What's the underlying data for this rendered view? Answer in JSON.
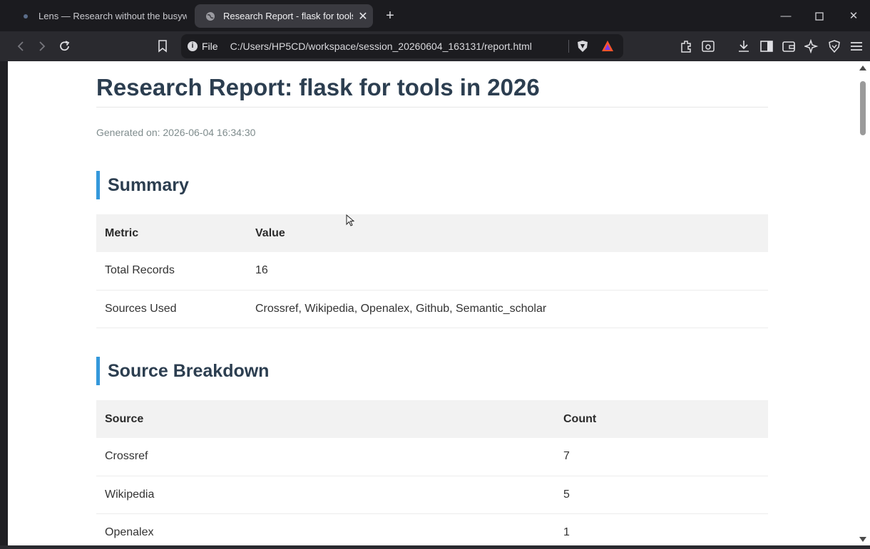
{
  "tabs": [
    {
      "title": "Lens — Research without the busywo",
      "active": false
    },
    {
      "title": "Research Report - flask for tools",
      "active": true
    }
  ],
  "toolbar": {
    "scheme": "File",
    "url": "C:/Users/HP5CD/workspace/session_20260604_163131/report.html"
  },
  "report": {
    "title": "Research Report: flask for tools in 2026",
    "generated": "Generated on: 2026-06-04 16:34:30",
    "summary": {
      "heading": "Summary",
      "columns": [
        "Metric",
        "Value"
      ],
      "rows": [
        [
          "Total Records",
          "16"
        ],
        [
          "Sources Used",
          "Crossref, Wikipedia, Openalex, Github, Semantic_scholar"
        ]
      ]
    },
    "breakdown": {
      "heading": "Source Breakdown",
      "columns": [
        "Source",
        "Count"
      ],
      "rows": [
        [
          "Crossref",
          "7"
        ],
        [
          "Wikipedia",
          "5"
        ],
        [
          "Openalex",
          "1"
        ]
      ]
    }
  },
  "colors": {
    "accent": "#3498db",
    "heading": "#2c3e50",
    "brave_shield": "#fb542b"
  }
}
